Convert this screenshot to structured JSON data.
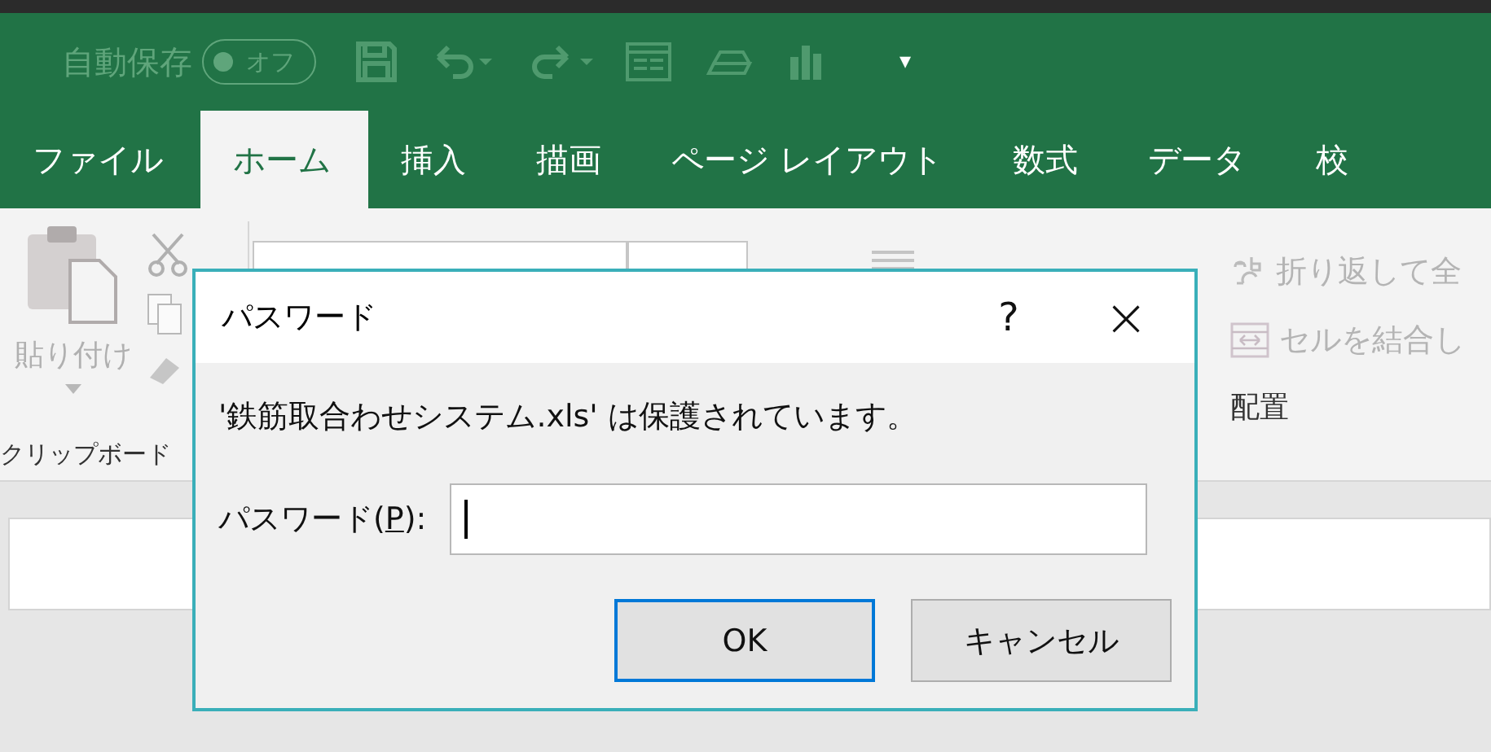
{
  "quick_access": {
    "autosave_label": "自動保存",
    "autosave_toggle": {
      "label": "オフ",
      "on": false
    },
    "more": "▾"
  },
  "tabs": [
    {
      "label": "ファイル",
      "selected": false
    },
    {
      "label": "ホーム",
      "selected": true
    },
    {
      "label": "挿入",
      "selected": false
    },
    {
      "label": "描画",
      "selected": false
    },
    {
      "label": "ページ レイアウト",
      "selected": false
    },
    {
      "label": "数式",
      "selected": false
    },
    {
      "label": "データ",
      "selected": false
    },
    {
      "label": "校",
      "selected": false
    }
  ],
  "ribbon": {
    "paste_label": "貼り付け",
    "clipboard_group": "クリップボード",
    "wrap_text": "折り返して全",
    "merge_cells": "セルを結合し",
    "alignment_group": "配置"
  },
  "dialog": {
    "title": "パスワード",
    "help": "?",
    "close": "×",
    "message": "'鉄筋取合わせシステム.xls' は保護されています。",
    "field_label": {
      "before": "パスワード(",
      "access_key": "P",
      "after": "):"
    },
    "buttons": [
      {
        "label": "OK",
        "default": true
      },
      {
        "label": "キャンセル",
        "default": false
      }
    ]
  }
}
